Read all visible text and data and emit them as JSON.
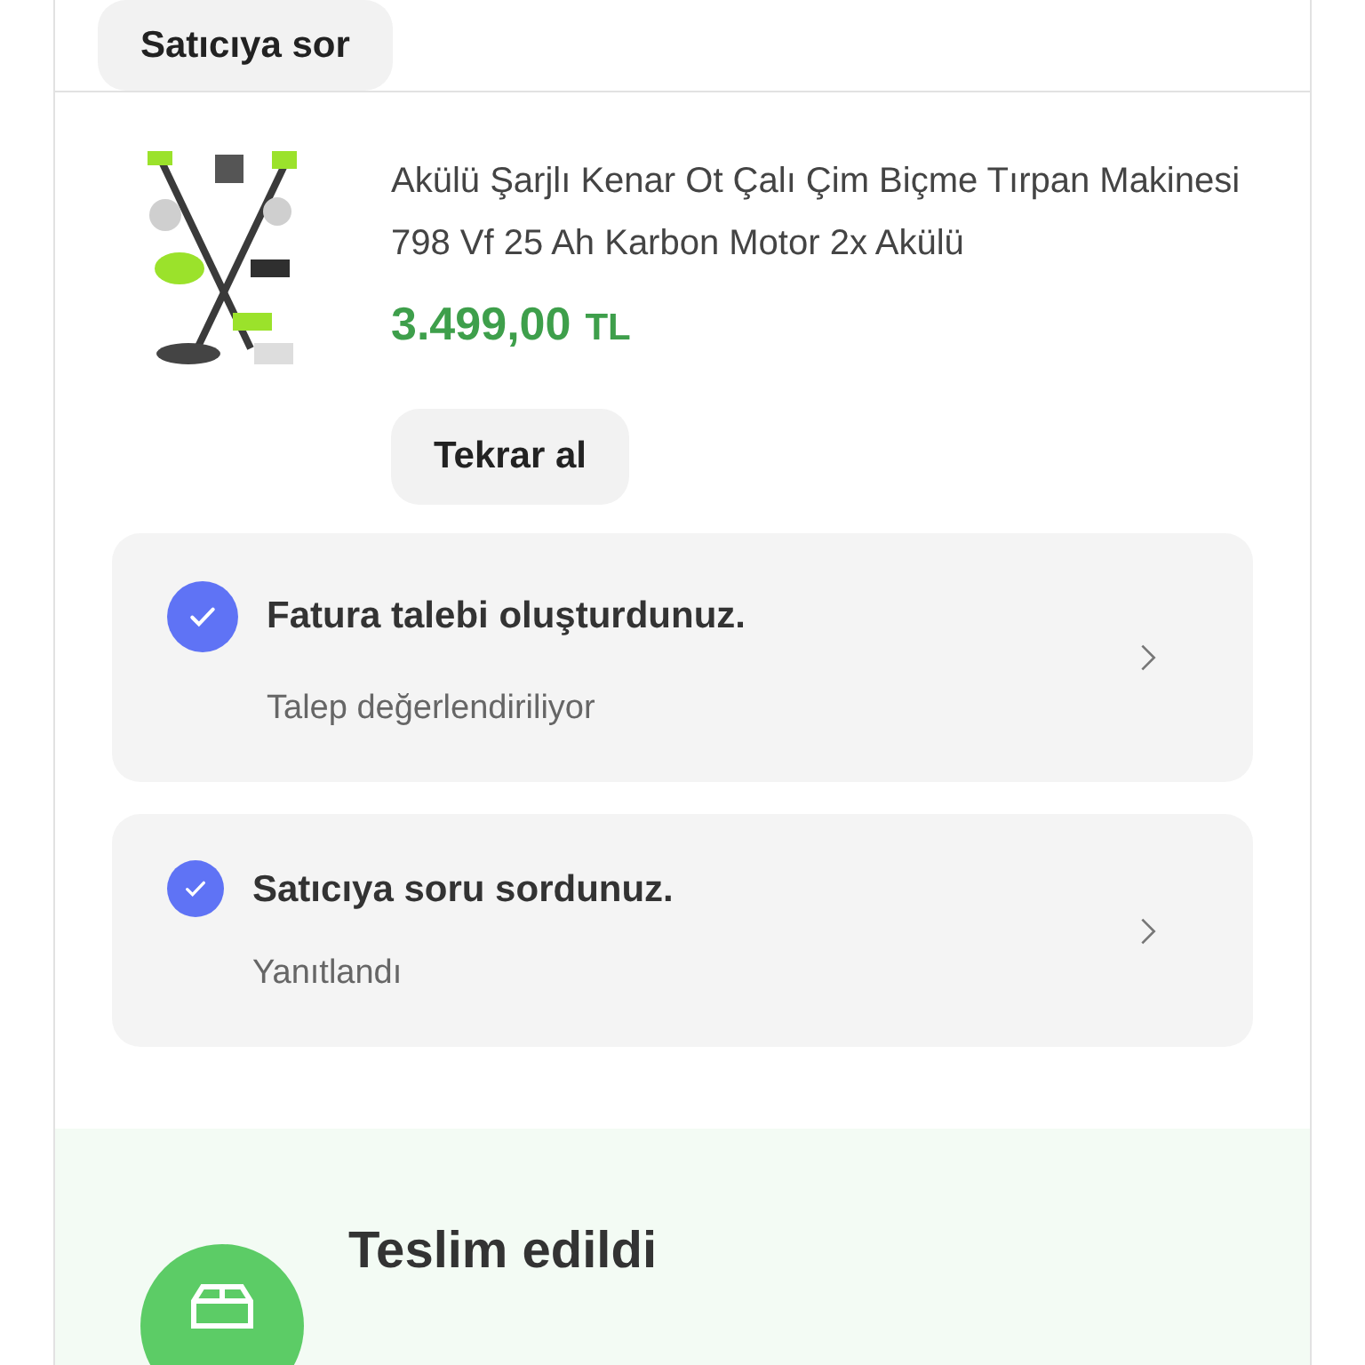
{
  "ask_seller_button": "Satıcıya sor",
  "product": {
    "title": "Akülü Şarjlı Kenar Ot Çalı Çim Biçme Tırpan Makinesi 798 Vf 25 Ah Karbon Motor 2x Akülü",
    "price": "3.499,00",
    "currency": "TL",
    "rebuy_button": "Tekrar al"
  },
  "status_cards": [
    {
      "title": "Fatura talebi oluşturdunuz.",
      "subtitle": "Talep değerlendiriliyor",
      "done": true
    },
    {
      "title": "Satıcıya soru sordunuz.",
      "subtitle": "Yanıtlandı",
      "done": true
    }
  ],
  "delivery": {
    "title": "Teslim edildi"
  }
}
